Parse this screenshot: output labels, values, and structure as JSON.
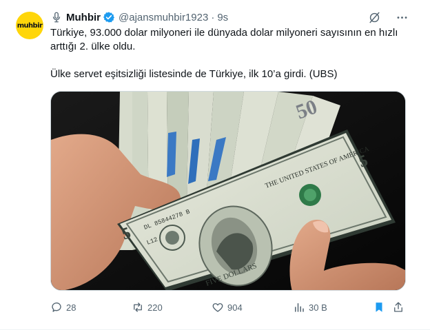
{
  "author": {
    "avatar_text": "muhbir",
    "name": "Muhbir",
    "handle": "@ajansmuhbir1923",
    "separator": "·",
    "time": "9s"
  },
  "tweet": {
    "line1": "Türkiye, 93.000 dolar milyoneri ile dünyada dolar milyoneri sayısının en hızlı arttığı 2. ülke oldu.",
    "line2": "Ülke servet eşitsizliği listesinde de Türkiye, ilk 10’a girdi. (UBS)"
  },
  "banknote": {
    "bill_number": "5",
    "bill_number_back": "50",
    "title": "THE UNITED STATES OF AMERICA",
    "serial": "DL 85844278 B",
    "letter": "L12",
    "denomination": "FIVE DOLLARS"
  },
  "actions": {
    "replies": "28",
    "reposts": "220",
    "likes": "904",
    "views": "30 B"
  },
  "colors": {
    "muted": "#536471",
    "accent": "#1d9bf0",
    "avatar_bg": "#ffd60a"
  },
  "icons": {
    "mic": "microphone-icon",
    "verified": "verified-badge-icon",
    "grok": "grok-icon",
    "more": "more-icon",
    "reply": "reply-icon",
    "repost": "repost-icon",
    "like": "like-icon",
    "views": "views-icon",
    "bookmark": "bookmark-icon",
    "share": "share-icon"
  }
}
